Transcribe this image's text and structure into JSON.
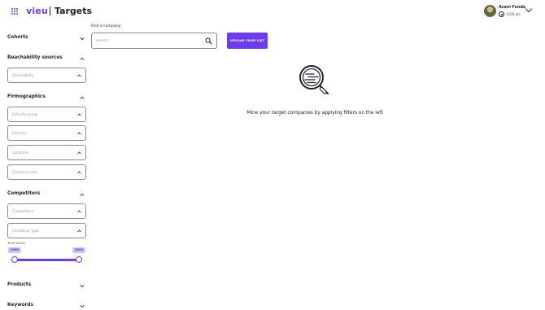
{
  "app": {
    "logo": "vieu",
    "page_title": "Targets"
  },
  "user": {
    "name": "Avani Funde",
    "points": "1200 pts"
  },
  "sidebar": {
    "sections": {
      "cohorts": "Cohorts",
      "reachability": "Reachability sources",
      "firmographics": "Firmographics",
      "competitors": "Competitors",
      "products": "Products",
      "keywords": "Keywords"
    },
    "selects": {
      "reachability": "Reachability",
      "industry_group": "Industry group",
      "industry": "Industry",
      "locations": "Locations",
      "company_size": "Company size",
      "competitors": "Competitors",
      "introducer_type": "Introducer type"
    },
    "time_frame": {
      "label": "Time frame",
      "start": "2000",
      "end": "2023",
      "range_fraction": [
        0.0,
        1.0
      ]
    }
  },
  "main": {
    "find_label": "Find a company",
    "search_placeholder": "Search",
    "upload_label": "UPLOAD YOUR LIST",
    "empty_message": "Mine your target companies by applying filters on the left"
  },
  "colors": {
    "accent": "#6b3cf0",
    "badge_bg": "#cfc3f7",
    "text": "#1f1f2e",
    "border": "#8a8a96"
  }
}
